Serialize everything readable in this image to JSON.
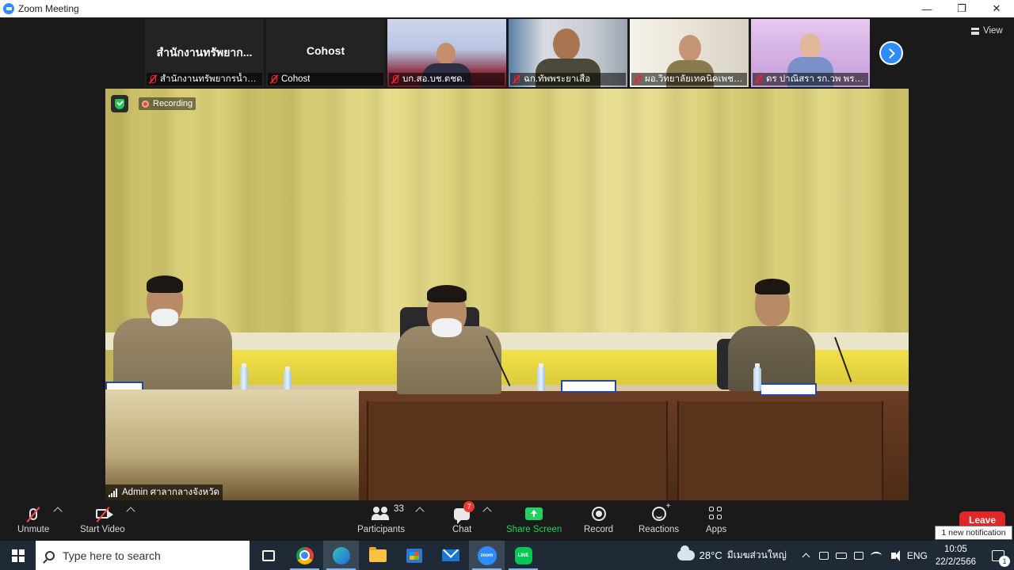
{
  "window": {
    "title": "Zoom Meeting",
    "minimize_glyph": "—",
    "restore_glyph": "❐",
    "close_glyph": "✕"
  },
  "top_bar": {
    "view_label": "View"
  },
  "thumbnails": [
    {
      "display_name": "สำนักงานทรัพยาก...",
      "label": "สำนักงานทรัพยากรน้ำที่7...",
      "has_video": false
    },
    {
      "display_name": "Cohost",
      "label": "Cohost",
      "has_video": false
    },
    {
      "label": "บก.สอ.บช.ตชด.",
      "has_video": true
    },
    {
      "label": "ฉก.ทัพพระยาเสือ",
      "has_video": true
    },
    {
      "label": "ผอ.วิทยาลัยเทคนิคเพชรบุรี",
      "has_video": true
    },
    {
      "label": "ดร ปาณิสรา รก.วพ พระจ...",
      "has_video": true
    }
  ],
  "main_video": {
    "recording_label": "Recording",
    "speaker_label": "Admin ศาลากลางจังหวัด"
  },
  "controls": {
    "unmute_label": "Unmute",
    "start_video_label": "Start Video",
    "participants_label": "Participants",
    "participants_count": "33",
    "chat_label": "Chat",
    "chat_badge": "7",
    "share_screen_label": "Share Screen",
    "record_label": "Record",
    "reactions_label": "Reactions",
    "apps_label": "Apps",
    "leave_label": "Leave",
    "notification_text": "1 new notification"
  },
  "taskbar": {
    "search_placeholder": "Type here to search",
    "weather_temp": "28°C",
    "weather_location": "มีเมฆส่วนใหญ่",
    "language": "ENG",
    "time": "10:05",
    "date": "22/2/2566",
    "notification_count": "1",
    "zoom_icon_text": "zoom",
    "line_icon_text": "LINE"
  },
  "colors": {
    "zoom_blue": "#2d8cff",
    "share_green": "#23d160",
    "leave_red": "#e02828",
    "meeting_bg": "#1a1a1a",
    "taskbar_bg": "#1f2a36"
  }
}
